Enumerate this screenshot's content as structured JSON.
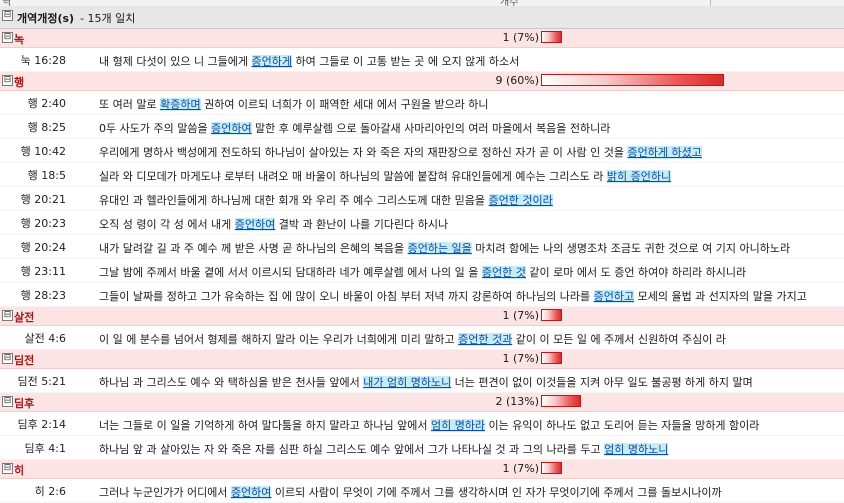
{
  "header": {
    "toggle": "⊟",
    "title": "개역개정(s)",
    "count": "- 15개 일치",
    "top_left_fragment": "역",
    "top_right_fragment": "개수"
  },
  "groups": [
    {
      "name": "녹",
      "toggle": "⊟",
      "count": "1 (7%)",
      "percent": 7,
      "verses": [
        {
          "ref": "눅 16:28",
          "before": "내 형제 다섯이 있으 니 그들에게 ",
          "hit": "증언하게",
          "after": " 하여 그들로 이 고통 받는 곳 에 오지 않게 하소서"
        }
      ]
    },
    {
      "name": "행",
      "toggle": "⊟",
      "count": "9 (60%)",
      "percent": 60,
      "verses": [
        {
          "ref": "행 2:40",
          "before": "또 여러 말로 ",
          "hit": "확증하며",
          "after": " 권하여 이르되 너희가 이 패역한 세대 에서 구원을 받으라 하니"
        },
        {
          "ref": "행 8:25",
          "before": "0두 사도가 주의 말씀을 ",
          "hit": "증언하여",
          "after": " 말한 후 예루살렘 으로 돌아갈새 사마리아인의 여러 마을에서 복음을 전하니라"
        },
        {
          "ref": "행 10:42",
          "before": "우리에게 명하사 백성에게 전도하되 하나님이 살아있는 자 와 죽은 자의 재판장으로 정하신 자가 곧 이 사람 인 것을 ",
          "hit": "증언하게 하셨고",
          "after": ""
        },
        {
          "ref": "행 18:5",
          "before": "실라 와 디모데가 마게도냐 로부터 내려오 매 바울이 하나님의 말씀에 붙잡혀 유대인들에게 예수는 그리스도 라 ",
          "hit": "밝히 증언하니",
          "after": ""
        },
        {
          "ref": "행 20:21",
          "before": "유대인 과 헬라인들에게 하나님께 대한 회개 와 우리 주 예수 그리스도께 대한 믿음을 ",
          "hit": "증언한 것이라",
          "after": ""
        },
        {
          "ref": "행 20:23",
          "before": "오직 성 령이 각 성 에서 내게 ",
          "hit": "증언하여",
          "after": " 결박 과 환난이 나를 기다린다 하시나"
        },
        {
          "ref": "행 20:24",
          "before": "내가 달려갈 길 과 주 예수 께 받은 사명 곧 하나님의 은혜의 복음을 ",
          "hit": "증언하는 일을",
          "after": " 마치려 함에는 나의 생명조차 조금도 귀한 것으로 여 기지 아니하노라"
        },
        {
          "ref": "행 23:11",
          "before": "그날 밤에 주께서 바울 곁에 서서 이르시되 담대하라 네가 예루살렘 에서 나의 일 을 ",
          "hit": "증언한 것",
          "after": " 같이 로마 에서 도 증언 하여야 하리라 하시니라"
        },
        {
          "ref": "행 28:23",
          "before": "그들이 날짜를 정하고 그가 유숙하는 집 에 많이 오니 바울이 아침 부터 저녁 까지 강론하여 하나님의 나라를 ",
          "hit": "증언하고",
          "after": " 모세의 율법 과 선지자의 말을 가지고"
        }
      ]
    },
    {
      "name": "살전",
      "toggle": "⊟",
      "count": "1 (7%)",
      "percent": 7,
      "verses": [
        {
          "ref": "살전 4:6",
          "before": "이 일 에 분수를 넘어서 형제를 해하지 말라 이는 우리가 너희에게 미리 말하고 ",
          "hit": "증언한 것과",
          "after": " 같이 이 모든 일 에 주께서 신원하여 주심이 라"
        }
      ]
    },
    {
      "name": "딤전",
      "toggle": "⊟",
      "count": "1 (7%)",
      "percent": 7,
      "verses": [
        {
          "ref": "딤전 5:21",
          "before": "하나님 과 그리스도 예수 와 택하심을 받은 천사들 앞에서 ",
          "hit": "내가 엄히 명하노니",
          "after": " 너는 편견이 없이 이것들을 지켜 아무 일도 불공평 하게 하지 말며"
        }
      ]
    },
    {
      "name": "딤후",
      "toggle": "⊟",
      "count": "2 (13%)",
      "percent": 13,
      "verses": [
        {
          "ref": "딤후 2:14",
          "before": "너는 그들로 이 일을 기억하게 하여 말다툼을 하지 말라고 하나님 앞에서 ",
          "hit": "엄히 명하라",
          "after": " 이는 유익이 하나도 없고 도리어 듣는 자들을 망하게 함이라"
        },
        {
          "ref": "딤후 4:1",
          "before": "하나님 앞 과 살아있는 자 와 죽은 자를 심판 하실 그리스도 예수 앞에서 그가 나타나실 것 과 그의 나라를 두고 ",
          "hit": "엄히 명하노니",
          "after": ""
        }
      ]
    },
    {
      "name": "히",
      "toggle": "⊟",
      "count": "1 (7%)",
      "percent": 7,
      "verses": [
        {
          "ref": "히 2:6",
          "before": "그러나 누군인가가 어디에서 ",
          "hit": "증언하여",
          "after": " 이르되 사람이 무엇이 기에 주께서 그를 생각하시며 인 자가 무엇이기에 주께서 그를 돌보시나이까"
        }
      ]
    }
  ]
}
